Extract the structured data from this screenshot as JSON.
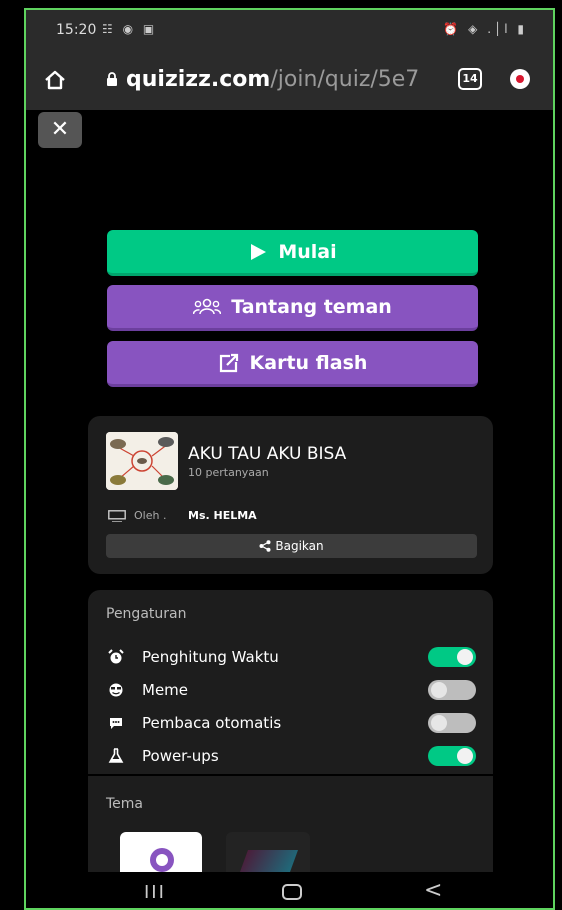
{
  "status_bar": {
    "time": "15:20",
    "notifications": "☷ ◉ ▣",
    "right_icons": "⏰ ◈ .│l ▮"
  },
  "browser": {
    "domain": "quizizz.com",
    "path": "/join/quiz/5e7",
    "tab_count": "14"
  },
  "close_label": "✕",
  "actions": {
    "start": "Mulai",
    "challenge": "Tantang teman",
    "flashcards": "Kartu flash"
  },
  "quiz": {
    "title": "AKU TAU AKU BISA",
    "question_count": "10 pertanyaan",
    "author_prefix": "Oleh .",
    "author": "Ms. HELMA",
    "share_label": "Bagikan"
  },
  "settings": {
    "title": "Pengaturan",
    "items": [
      {
        "label": "Penghitung Waktu",
        "icon": "alarm-icon",
        "enabled": true
      },
      {
        "label": "Meme",
        "icon": "meme-icon",
        "enabled": false
      },
      {
        "label": "Pembaca otomatis",
        "icon": "speech-icon",
        "enabled": false
      },
      {
        "label": "Power-ups",
        "icon": "flask-icon",
        "enabled": true
      }
    ]
  },
  "theme": {
    "title": "Tema"
  },
  "nav": {
    "recent": "III",
    "back": "<"
  },
  "colors": {
    "green": "#00c985",
    "purple": "#8854c0",
    "toggle_off": "#bdbdbd"
  }
}
